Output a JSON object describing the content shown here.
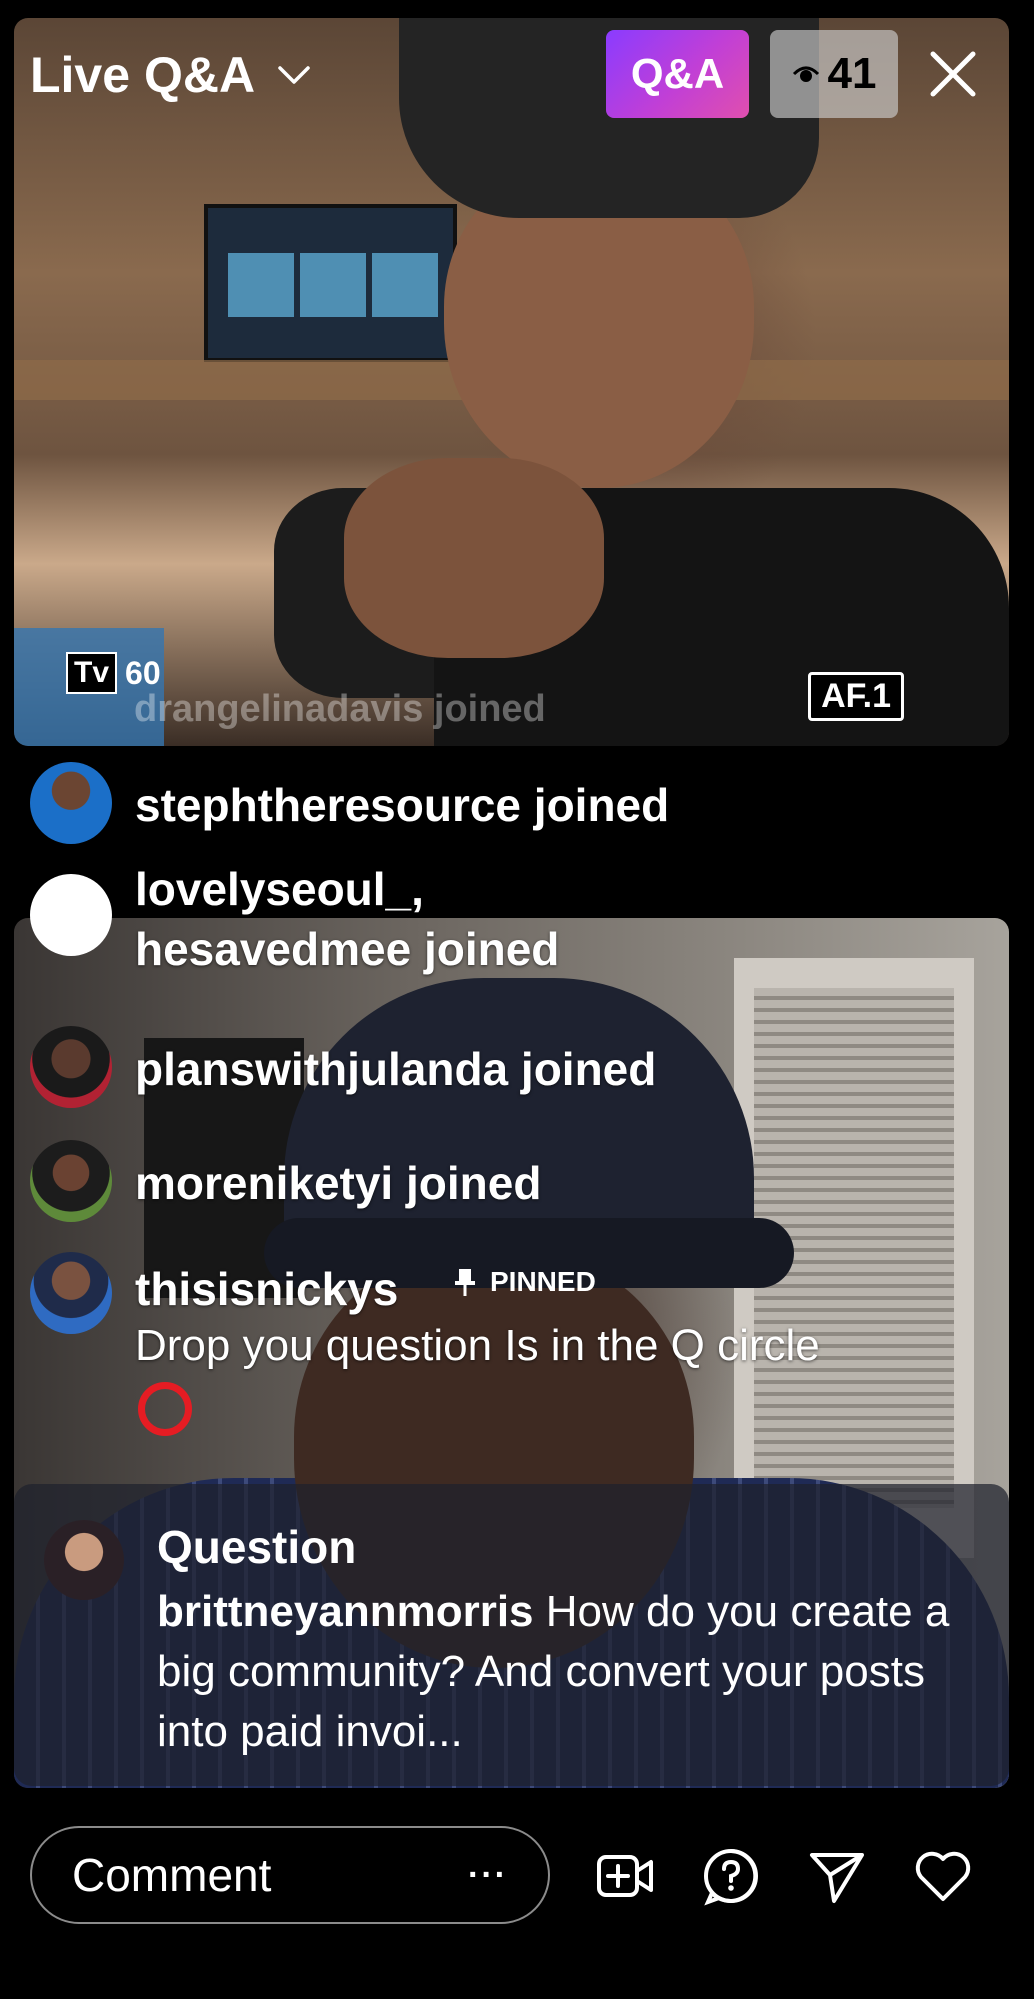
{
  "header": {
    "title": "Live Q&A",
    "qa_button_label": "Q&A",
    "viewer_count": "41"
  },
  "top_video": {
    "tv_label": "Tv",
    "tv_value": "60",
    "af_label": "AF.1",
    "ghost_join_text": "drangelinadavis joined"
  },
  "comments": [
    {
      "text": "stephtheresource joined"
    },
    {
      "text": "lovelyseoul_,",
      "text2": "hesavedmee joined"
    },
    {
      "text": "planswithjulanda joined"
    },
    {
      "text": "moreniketyi joined"
    }
  ],
  "pinned_comment": {
    "username": "thisisnickys",
    "badge": "PINNED",
    "message": "Drop you question Is in the Q circle"
  },
  "question": {
    "label": "Question",
    "username": "brittneyannmorris",
    "text": "How do you create a big community? And convert your posts into paid invoi..."
  },
  "bottom_bar": {
    "comment_placeholder": "Comment",
    "more_label": "···"
  },
  "colors": {
    "qa_gradient_start": "#8a3cff",
    "qa_gradient_end": "#e04fae",
    "pinned_circle": "#e51c23"
  }
}
